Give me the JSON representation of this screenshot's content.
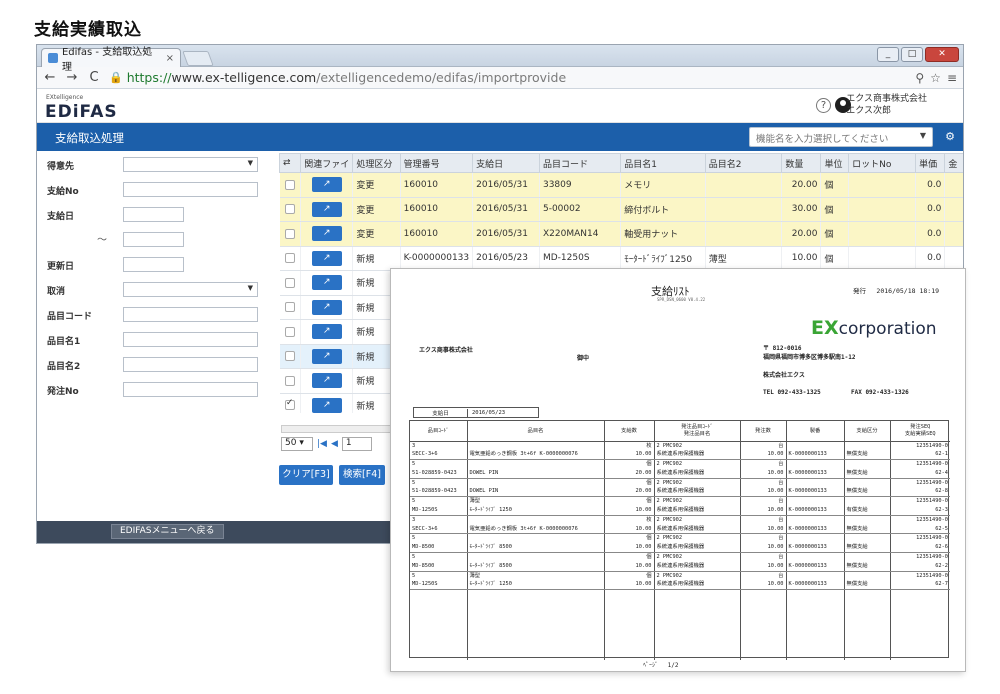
{
  "caption": "支給実績取込",
  "browser": {
    "tab_title": "Edifas - 支給取込処理",
    "tab_close": "×",
    "url_scheme": "https://",
    "url_host": "www.ex-telligence.com",
    "url_path": "/extelligencedemo/edifas/importprovide"
  },
  "app": {
    "logo_small": "EXtelligence",
    "logo": "EDiFAS",
    "help": "?",
    "company": "エクス商事株式会社",
    "user": "エクス次郎",
    "screen_title": "支給取込処理",
    "func_placeholder": "機能名を入力選択してください"
  },
  "form": {
    "labels": [
      "得意先",
      "支給No",
      "支給日",
      "",
      "更新日",
      "取消",
      "品目コード",
      "品目名1",
      "品目名2",
      "発注No"
    ],
    "tilde": "～"
  },
  "grid": {
    "headers": [
      "",
      "関連ファイ",
      "処理区分",
      "管理番号",
      "支給日",
      "品目コード",
      "品目名1",
      "品目名2",
      "数量",
      "単位",
      "ロットNo",
      "単価",
      "金"
    ],
    "rows": [
      {
        "style": "yellow",
        "checked": false,
        "kubun": "変更",
        "kanri": "160010",
        "date": "2016/05/31",
        "code": "33809",
        "name1": "メモリ",
        "name2": "",
        "qty": "20.00",
        "unit": "個",
        "lot": "",
        "price": "0.0"
      },
      {
        "style": "yellow",
        "checked": false,
        "kubun": "変更",
        "kanri": "160010",
        "date": "2016/05/31",
        "code": "5-00002",
        "name1": "締付ボルト",
        "name2": "",
        "qty": "30.00",
        "unit": "個",
        "lot": "",
        "price": "0.0"
      },
      {
        "style": "yellow",
        "checked": false,
        "kubun": "変更",
        "kanri": "160010",
        "date": "2016/05/31",
        "code": "X220MAN14",
        "name1": "軸受用ナット",
        "name2": "",
        "qty": "20.00",
        "unit": "個",
        "lot": "",
        "price": "0.0"
      },
      {
        "style": "white",
        "checked": false,
        "kubun": "新規",
        "kanri": "K-0000000133",
        "date": "2016/05/23",
        "code": "MD-1250S",
        "name1": "ﾓｰﾀｰﾄﾞﾗｲﾌﾞ1250",
        "name2": "薄型",
        "qty": "10.00",
        "unit": "個",
        "lot": "",
        "price": "0.0"
      },
      {
        "style": "white",
        "checked": false,
        "kubun": "新規",
        "kanri": "",
        "date": "",
        "code": "",
        "name1": "",
        "name2": "",
        "qty": "",
        "unit": "",
        "lot": "",
        "price": ""
      },
      {
        "style": "white",
        "checked": false,
        "kubun": "新規",
        "kanri": "",
        "date": "",
        "code": "",
        "name1": "",
        "name2": "",
        "qty": "",
        "unit": "",
        "lot": "",
        "price": ""
      },
      {
        "style": "white",
        "checked": false,
        "kubun": "新規",
        "kanri": "",
        "date": "",
        "code": "",
        "name1": "",
        "name2": "",
        "qty": "",
        "unit": "",
        "lot": "",
        "price": ""
      },
      {
        "style": "blue",
        "checked": false,
        "kubun": "新規",
        "kanri": "",
        "date": "",
        "code": "",
        "name1": "",
        "name2": "",
        "qty": "",
        "unit": "",
        "lot": "",
        "price": ""
      },
      {
        "style": "white",
        "checked": false,
        "kubun": "新規",
        "kanri": "",
        "date": "",
        "code": "",
        "name1": "",
        "name2": "",
        "qty": "",
        "unit": "",
        "lot": "",
        "price": ""
      },
      {
        "style": "white",
        "checked": true,
        "kubun": "新規",
        "kanri": "",
        "date": "",
        "code": "",
        "name1": "",
        "name2": "",
        "qty": "",
        "unit": "",
        "lot": "",
        "price": ""
      }
    ],
    "edit_icon": "↗"
  },
  "pager": {
    "size": "50",
    "page": "1"
  },
  "buttons": {
    "clear": "クリア[F3]",
    "search": "検索[F4]",
    "menu_back": "EDIFASメニューへ戻る"
  },
  "report": {
    "title": "支給ﾘｽﾄ",
    "subtitle": "SPR_DSN_0600 V0.4.22",
    "issued": "発行　 2016/05/18 18:19",
    "brand_ex": "EX",
    "brand_rest": "corporation",
    "customer": "エクス商事株式会社",
    "onchu": "御中",
    "zip": "〒 812-0016",
    "address": "福岡県福岡市博多区博多駅南1-12",
    "company": "株式会社エクス",
    "tel": "TEL  092-433-1325",
    "fax": "FAX  092-433-1326",
    "date_label": "支給日",
    "date_value": "2016/05/23",
    "headers": [
      "品目ｺｰﾄﾞ",
      "品目名",
      "支給数",
      "発注品目ｺｰﾄﾞ\n発注品目名",
      "発注数",
      "製番",
      "支給区分",
      "発注SEQ\n支給実績SEQ"
    ],
    "rows": [
      {
        "c1": "3",
        "c2": "",
        "c3": "枚",
        "c4": "2 PMC902",
        "c5": "台",
        "c6": "",
        "c7": "",
        "c8": "12351490-0",
        "d1": "SECC-3+6",
        "d2": "電気亜鉛めっき鋼板 3t+6f  K-0000000076",
        "d3": "10.00",
        "d4": "系統連系用保護機器",
        "d5": "10.00",
        "d6": "K-0000000133",
        "d7": "無償支給",
        "d8": "62-1"
      },
      {
        "c1": "5",
        "c2": "",
        "c3": "個",
        "c4": "2 PMC902",
        "c5": "台",
        "c6": "",
        "c7": "",
        "c8": "12351490-0",
        "d1": "51-028859-0423",
        "d2": "DOWEL PIN",
        "d3": "20.00",
        "d4": "系統連系用保護機器",
        "d5": "10.00",
        "d6": "K-0000000133",
        "d7": "無償支給",
        "d8": "62-4"
      },
      {
        "c1": "5",
        "c2": "",
        "c3": "個",
        "c4": "2 PMC902",
        "c5": "台",
        "c6": "",
        "c7": "",
        "c8": "12351490-0",
        "d1": "51-028859-0423",
        "d2": "DOWEL PIN",
        "d3": "20.00",
        "d4": "系統連系用保護機器",
        "d5": "10.00",
        "d6": "K-0000000133",
        "d7": "無償支給",
        "d8": "62-8"
      },
      {
        "c1": "5",
        "c2": "薄型",
        "c3": "個",
        "c4": "2 PMC902",
        "c5": "台",
        "c6": "",
        "c7": "",
        "c8": "12351490-0",
        "d1": "MD-1250S",
        "d2": "ﾓｰﾀｰﾄﾞﾗｲﾌﾞ 1250",
        "d3": "10.00",
        "d4": "系統連系用保護機器",
        "d5": "10.00",
        "d6": "K-0000000133",
        "d7": "有償支給",
        "d8": "62-3"
      },
      {
        "c1": "3",
        "c2": "",
        "c3": "枚",
        "c4": "2 PMC902",
        "c5": "台",
        "c6": "",
        "c7": "",
        "c8": "12351490-0",
        "d1": "SECC-3+6",
        "d2": "電気亜鉛めっき鋼板 3t+6f  K-0000000076",
        "d3": "10.00",
        "d4": "系統連系用保護機器",
        "d5": "10.00",
        "d6": "K-0000000133",
        "d7": "無償支給",
        "d8": "62-5"
      },
      {
        "c1": "5",
        "c2": "",
        "c3": "個",
        "c4": "2 PMC902",
        "c5": "台",
        "c6": "",
        "c7": "",
        "c8": "12351490-0",
        "d1": "MD-8500",
        "d2": "ﾓｰﾀｰﾄﾞﾗｲﾌﾞ 8500",
        "d3": "10.00",
        "d4": "系統連系用保護機器",
        "d5": "10.00",
        "d6": "K-0000000133",
        "d7": "無償支給",
        "d8": "62-6"
      },
      {
        "c1": "5",
        "c2": "",
        "c3": "個",
        "c4": "2 PMC902",
        "c5": "台",
        "c6": "",
        "c7": "",
        "c8": "12351490-0",
        "d1": "MD-8500",
        "d2": "ﾓｰﾀｰﾄﾞﾗｲﾌﾞ 8500",
        "d3": "10.00",
        "d4": "系統連系用保護機器",
        "d5": "10.00",
        "d6": "K-0000000133",
        "d7": "無償支給",
        "d8": "62-2"
      },
      {
        "c1": "5",
        "c2": "薄型",
        "c3": "個",
        "c4": "2 PMC902",
        "c5": "台",
        "c6": "",
        "c7": "",
        "c8": "12351490-0",
        "d1": "MD-1250S",
        "d2": "ﾓｰﾀｰﾄﾞﾗｲﾌﾞ 1250",
        "d3": "10.00",
        "d4": "系統連系用保護機器",
        "d5": "10.00",
        "d6": "K-0000000133",
        "d7": "無償支給",
        "d8": "62-7"
      }
    ],
    "page": "ﾍﾟｰｼﾞ　 1/2"
  }
}
